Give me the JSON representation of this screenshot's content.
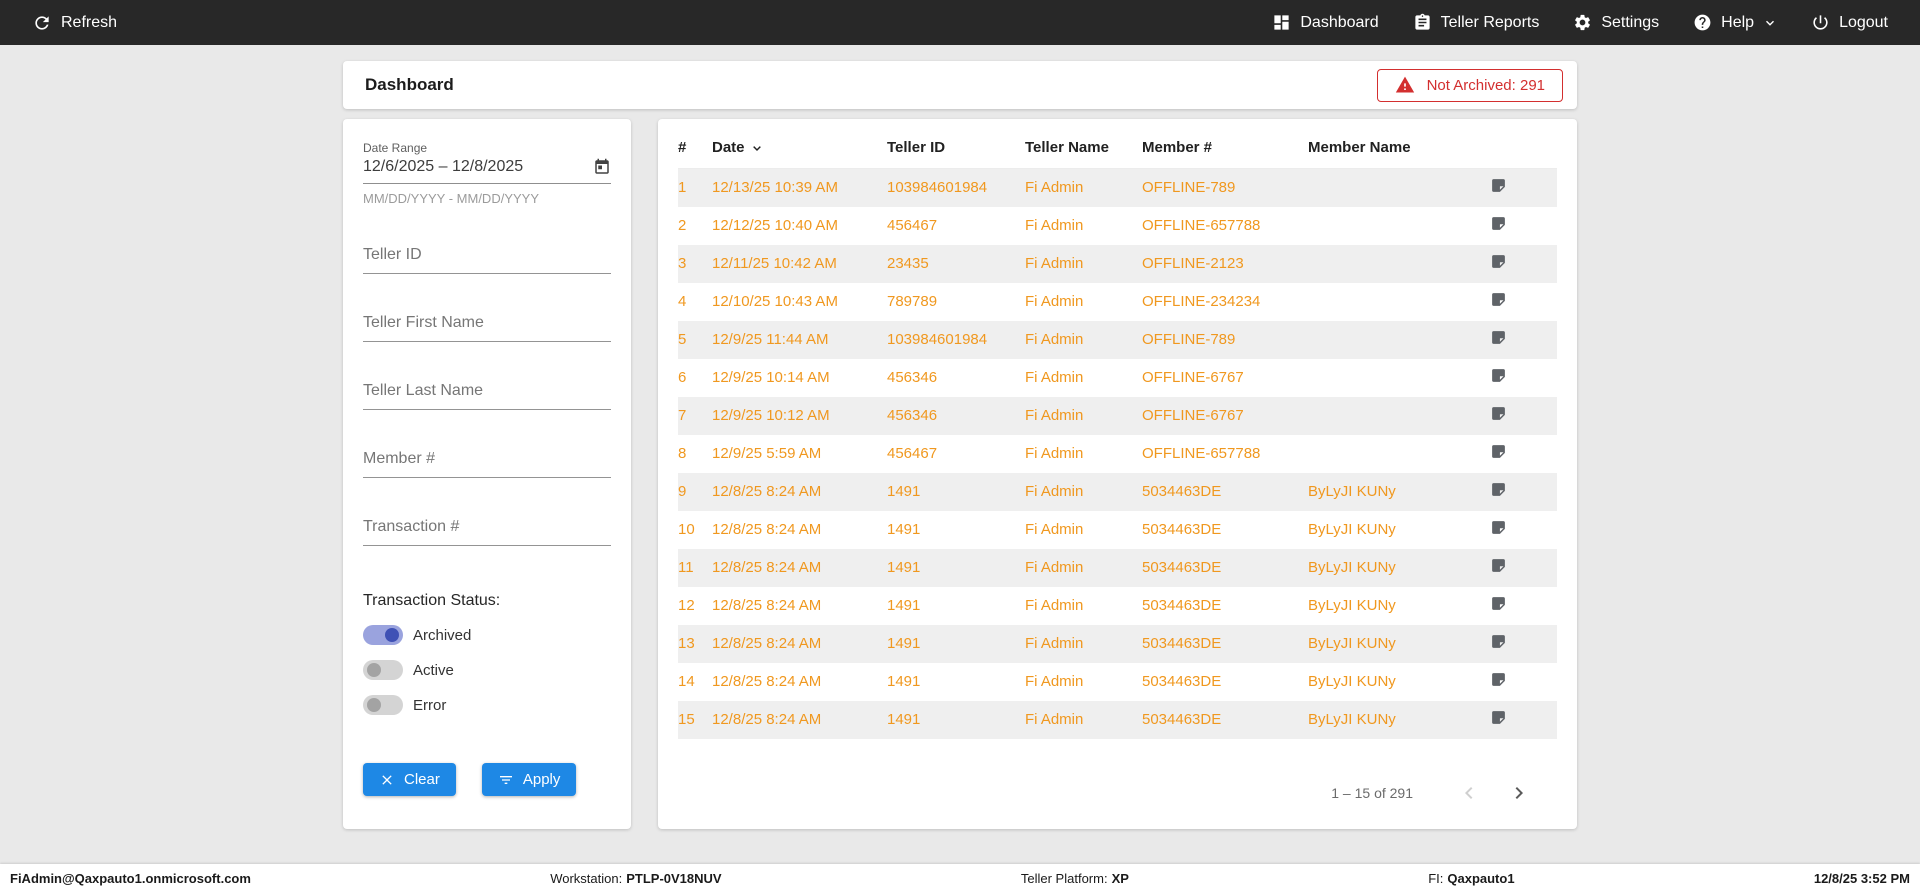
{
  "colors": {
    "topbar_bg": "#282828",
    "accent_blue": "#1E88E5",
    "data_orange": "#F0981F",
    "alert_red": "#D32F2F",
    "toggle_on": "#3F51B5"
  },
  "topbar": {
    "refresh_label": "Refresh",
    "nav": [
      {
        "label": "Dashboard",
        "icon": "dashboard-icon"
      },
      {
        "label": "Teller Reports",
        "icon": "reports-icon"
      },
      {
        "label": "Settings",
        "icon": "gear-icon"
      },
      {
        "label": "Help",
        "icon": "help-icon"
      },
      {
        "label": "Logout",
        "icon": "power-icon"
      }
    ]
  },
  "header": {
    "title": "Dashboard",
    "not_archived_badge": "Not Archived: 291"
  },
  "filters": {
    "date_range": {
      "label": "Date Range",
      "value": "12/6/2025 – 12/8/2025",
      "hint": "MM/DD/YYYY - MM/DD/YYYY"
    },
    "fields": [
      {
        "placeholder": "Teller ID"
      },
      {
        "placeholder": "Teller First Name"
      },
      {
        "placeholder": "Teller Last Name"
      },
      {
        "placeholder": "Member #"
      },
      {
        "placeholder": "Transaction #"
      }
    ],
    "status_label": "Transaction Status:",
    "toggles": [
      {
        "label": "Archived",
        "on": true
      },
      {
        "label": "Active",
        "on": false
      },
      {
        "label": "Error",
        "on": false
      }
    ],
    "clear_label": "Clear",
    "apply_label": "Apply"
  },
  "table": {
    "columns": [
      "#",
      "Date",
      "Teller ID",
      "Teller Name",
      "Member #",
      "Member Name"
    ],
    "rows": [
      {
        "num": "1",
        "date": "12/13/25 10:39 AM",
        "teller_id": "103984601984",
        "teller_name": "Fi Admin",
        "member": "OFFLINE-789",
        "member_name": ""
      },
      {
        "num": "2",
        "date": "12/12/25 10:40 AM",
        "teller_id": "456467",
        "teller_name": "Fi Admin",
        "member": "OFFLINE-657788",
        "member_name": ""
      },
      {
        "num": "3",
        "date": "12/11/25 10:42 AM",
        "teller_id": "23435",
        "teller_name": "Fi Admin",
        "member": "OFFLINE-2123",
        "member_name": ""
      },
      {
        "num": "4",
        "date": "12/10/25 10:43 AM",
        "teller_id": "789789",
        "teller_name": "Fi Admin",
        "member": "OFFLINE-234234",
        "member_name": ""
      },
      {
        "num": "5",
        "date": "12/9/25 11:44 AM",
        "teller_id": "103984601984",
        "teller_name": "Fi Admin",
        "member": "OFFLINE-789",
        "member_name": ""
      },
      {
        "num": "6",
        "date": "12/9/25 10:14 AM",
        "teller_id": "456346",
        "teller_name": "Fi Admin",
        "member": "OFFLINE-6767",
        "member_name": ""
      },
      {
        "num": "7",
        "date": "12/9/25 10:12 AM",
        "teller_id": "456346",
        "teller_name": "Fi Admin",
        "member": "OFFLINE-6767",
        "member_name": ""
      },
      {
        "num": "8",
        "date": "12/9/25 5:59 AM",
        "teller_id": "456467",
        "teller_name": "Fi Admin",
        "member": "OFFLINE-657788",
        "member_name": ""
      },
      {
        "num": "9",
        "date": "12/8/25 8:24 AM",
        "teller_id": "1491",
        "teller_name": "Fi Admin",
        "member": "5034463DE",
        "member_name": "ByLyJI KUNy"
      },
      {
        "num": "10",
        "date": "12/8/25 8:24 AM",
        "teller_id": "1491",
        "teller_name": "Fi Admin",
        "member": "5034463DE",
        "member_name": "ByLyJI KUNy"
      },
      {
        "num": "11",
        "date": "12/8/25 8:24 AM",
        "teller_id": "1491",
        "teller_name": "Fi Admin",
        "member": "5034463DE",
        "member_name": "ByLyJI KUNy"
      },
      {
        "num": "12",
        "date": "12/8/25 8:24 AM",
        "teller_id": "1491",
        "teller_name": "Fi Admin",
        "member": "5034463DE",
        "member_name": "ByLyJI KUNy"
      },
      {
        "num": "13",
        "date": "12/8/25 8:24 AM",
        "teller_id": "1491",
        "teller_name": "Fi Admin",
        "member": "5034463DE",
        "member_name": "ByLyJI KUNy"
      },
      {
        "num": "14",
        "date": "12/8/25 8:24 AM",
        "teller_id": "1491",
        "teller_name": "Fi Admin",
        "member": "5034463DE",
        "member_name": "ByLyJI KUNy"
      },
      {
        "num": "15",
        "date": "12/8/25 8:24 AM",
        "teller_id": "1491",
        "teller_name": "Fi Admin",
        "member": "5034463DE",
        "member_name": "ByLyJI KUNy"
      }
    ],
    "pagination": {
      "range_label": "1 – 15 of 291"
    }
  },
  "statusbar": {
    "user": "FiAdmin@Qaxpauto1.onmicrosoft.com",
    "workstation_label": "Workstation:",
    "workstation_value": "PTLP-0V18NUV",
    "platform_label": "Teller Platform:",
    "platform_value": "XP",
    "fi_label": "FI:",
    "fi_value": "Qaxpauto1",
    "datetime": "12/8/25 3:52 PM"
  }
}
